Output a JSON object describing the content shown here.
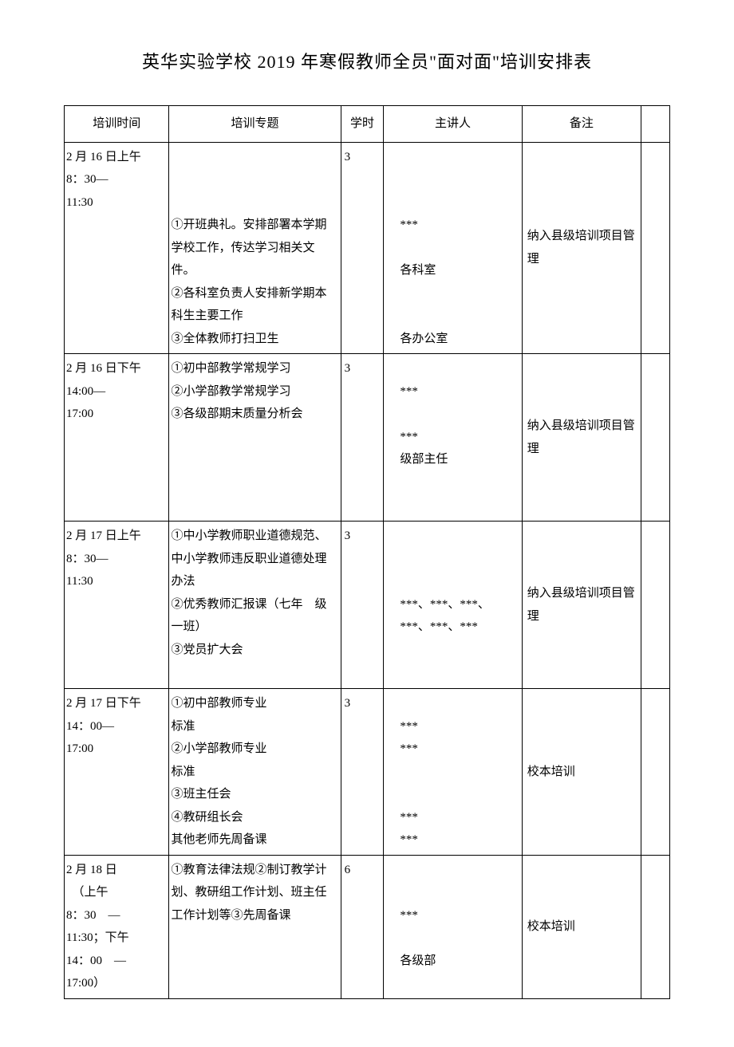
{
  "title": "英华实验学校 2019 年寒假教师全员\"面对面\"培训安排表",
  "headers": {
    "time": "培训时间",
    "topic": "培训专题",
    "hours": "学时",
    "speaker": "主讲人",
    "note": "备注"
  },
  "rows": [
    {
      "time": "2 月 16 日上午\n8：30—\n11:30",
      "topic": "\n\n\n①开班典礼。安排部署本学期学校工作，传达学习相关文件。\n②各科室负责人安排新学期本科生主要工作\n③全体教师打扫卫生",
      "hours": "3",
      "speaker": "\n\n\n***\n\n各科室\n\n\n各办公室",
      "note": "纳入县级培训项目管理"
    },
    {
      "time": "2 月 16 日下午\n14:00—\n17:00",
      "topic": "①初中部教学常规学习\n②小学部教学常规学习\n③各级部期末质量分析会",
      "hours": "3",
      "speaker": "\n***\n\n***\n级部主任",
      "note": "纳入县级培训项目管理"
    },
    {
      "time": "2 月 17 日上午\n8：30—\n11:30",
      "topic": "①中小学教师职业道德规范、中小学教师违反职业道德处理办法\n②优秀教师汇报课（七年　级一班）\n③党员扩大会",
      "hours": "3",
      "speaker": "\n\n\n***、***、***、\n***、***、***",
      "note": "纳入县级培训项目管理"
    },
    {
      "time": "2 月 17 日下午\n14：00—\n17:00",
      "topic": "①初中部教师专业\n标准\n②小学部教师专业\n标准\n③班主任会\n④教研组长会\n其他老师先周备课",
      "hours": "3",
      "speaker": "\n***\n***\n\n\n***\n***",
      "note": "校本培训"
    },
    {
      "time": "2 月 18 日\n　（上午\n8：30　—\n11:30；下午\n14：00　—\n17:00）",
      "topic": "①教育法律法规②制订教学计划、教研组工作计划、班主任工作计划等③先周备课",
      "hours": "6",
      "speaker": "\n\n***\n\n各级部",
      "note": "校本培训"
    }
  ]
}
